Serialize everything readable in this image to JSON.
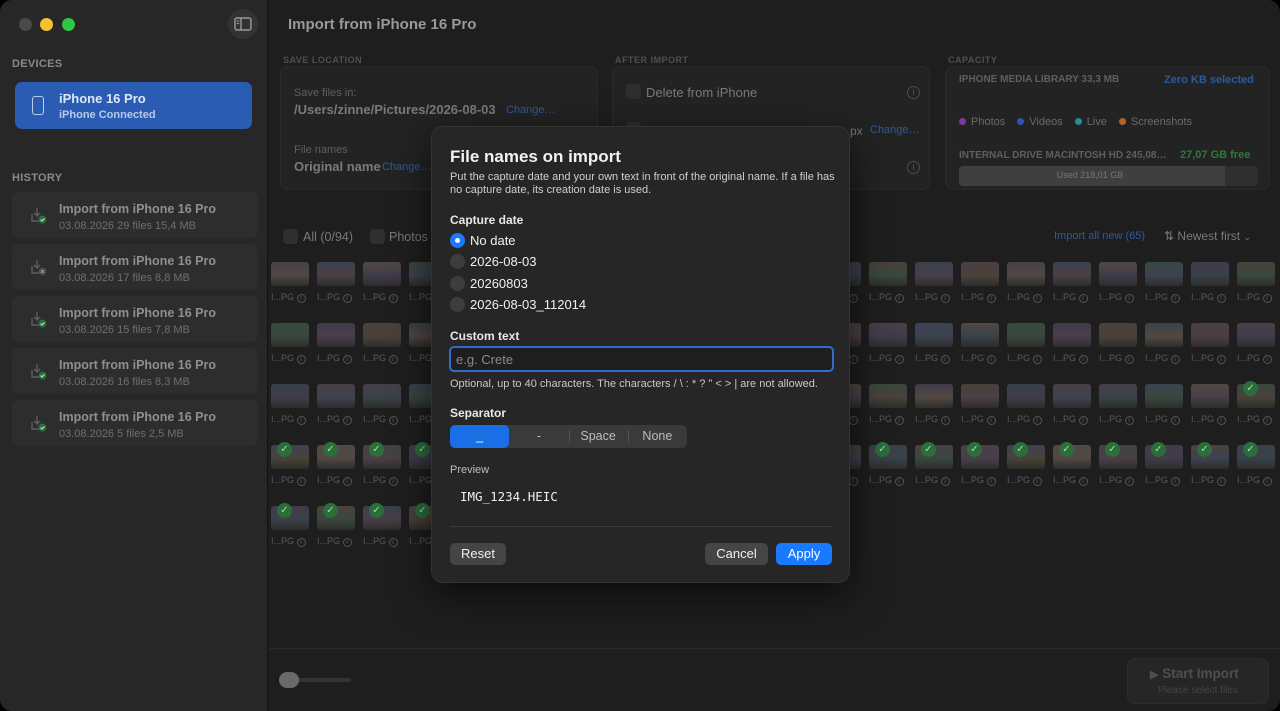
{
  "window": {
    "title": "Import from iPhone 16 Pro"
  },
  "sidebar": {
    "devices_header": "DEVICES",
    "device": {
      "name": "iPhone 16 Pro",
      "sub": "iPhone  Connected"
    },
    "history_header": "HISTORY",
    "history": [
      {
        "title": "Import from iPhone 16 Pro",
        "sub": "03.08.2026  29 files  15,4 MB",
        "status": "success"
      },
      {
        "title": "Import from iPhone 16 Pro",
        "sub": "03.08.2026  17 files  8,8 MB",
        "status": "cancelled"
      },
      {
        "title": "Import from iPhone 16 Pro",
        "sub": "03.08.2026  15 files  7,8 MB",
        "status": "success"
      },
      {
        "title": "Import from iPhone 16 Pro",
        "sub": "03.08.2026  16 files  8,3 MB",
        "status": "success"
      },
      {
        "title": "Import from iPhone 16 Pro",
        "sub": "03.08.2026  5 files  2,5 MB",
        "status": "success"
      }
    ]
  },
  "save_location": {
    "header": "SAVE LOCATION",
    "save_label": "Save files in:",
    "path": "/Users/zinne/Pictures/2026-08-03",
    "change": "Change…",
    "names_label": "File names",
    "names_value": "Original name",
    "names_change": "Change…"
  },
  "after_import": {
    "header": "AFTER IMPORT",
    "delete_label": "Delete from iPhone",
    "resize_value": "px",
    "resize_change": "Change…"
  },
  "capacity": {
    "header": "CAPACITY",
    "library_label": "IPHONE MEDIA LIBRARY 33,3 MB",
    "selected": "Zero KB selected",
    "legend": [
      {
        "label": "Photos",
        "color": "#7a3aa0"
      },
      {
        "label": "Videos",
        "color": "#2b55b0"
      },
      {
        "label": "Live",
        "color": "#2a8aa0"
      },
      {
        "label": "Screenshots",
        "color": "#b5622a"
      }
    ],
    "drive_label": "INTERNAL DRIVE MACINTOSH HD 245,08…",
    "drive_free": "27,07 GB free",
    "used_label": "Used 218,01 GB",
    "used_fraction": 0.89
  },
  "filters": {
    "all": "All (0/94)",
    "photos": "Photos",
    "import_all": "Import all new (65)",
    "sort": "Newest first"
  },
  "grid": {
    "file_label": "I...PG",
    "info_glyph": "i",
    "check_glyph": "✓",
    "palettes": [
      "#6a5a6e",
      "#55607a",
      "#7a6a62",
      "#4e6a5a",
      "#5d5470",
      "#6b6050",
      "#4f5e6e",
      "#705a64"
    ]
  },
  "dialog": {
    "title": "File names on import",
    "description": "Put the capture date and your own text in front of the original name. If a file has no capture date, its creation date is used.",
    "capture_header": "Capture date",
    "capture_options": [
      "No date",
      "2026-08-03",
      "20260803",
      "2026-08-03_112014"
    ],
    "capture_selected": 0,
    "custom_header": "Custom text",
    "custom_value": "",
    "custom_placeholder": "e.g. Crete",
    "custom_hint": "Optional, up to 40 characters. The characters / \\ : * ? \" < > | are not allowed.",
    "separator_header": "Separator",
    "separator_options": [
      "_",
      "-",
      "Space",
      "None"
    ],
    "separator_selected": 0,
    "preview_label": "Preview",
    "preview_value": "IMG_1234.HEIC",
    "reset": "Reset",
    "cancel": "Cancel",
    "apply": "Apply"
  },
  "bottom": {
    "start_label": "Start Import",
    "start_sub": "Please select files",
    "play_glyph": "▶"
  }
}
